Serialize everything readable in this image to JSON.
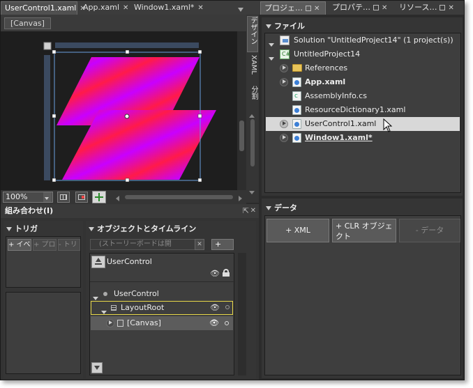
{
  "doc_tabs": [
    {
      "label": "UserControl1.xaml",
      "active": true
    },
    {
      "label": "App.xaml",
      "active": false
    },
    {
      "label": "Window1.xaml*",
      "active": false
    }
  ],
  "panel_tabs": [
    {
      "label": "プロジェ…",
      "active": true
    },
    {
      "label": "プロパテ…",
      "active": false
    },
    {
      "label": "リソース…",
      "active": false
    }
  ],
  "breadcrumb": "[Canvas]",
  "side_tabs": [
    "デザイン",
    "XAML",
    "分割"
  ],
  "zoom": "100%",
  "files": {
    "header": "ファイル",
    "items": [
      {
        "label": "Solution \"UntitledProject14\" (1 project(s))",
        "icon": "solution-icon",
        "bold": false
      },
      {
        "label": "UntitledProject14",
        "icon": "project-icon",
        "bold": false
      },
      {
        "label": "References",
        "icon": "folder-icon",
        "bold": false
      },
      {
        "label": "App.xaml",
        "icon": "xaml-file-icon",
        "bold": true
      },
      {
        "label": "AssemblyInfo.cs",
        "icon": "cs-file-icon",
        "bold": false
      },
      {
        "label": "ResourceDictionary1.xaml",
        "icon": "xaml-file-icon",
        "bold": false
      },
      {
        "label": "UserControl1.xaml",
        "icon": "xaml-file-icon",
        "bold": false
      },
      {
        "label": "Window1.xaml*",
        "icon": "xaml-file-icon",
        "bold": true
      }
    ]
  },
  "data_panel": {
    "header": "データ",
    "buttons": [
      "+ XML",
      "+ CLR オブジェクト",
      "- データ"
    ]
  },
  "interaction": {
    "header": "組み合わせ(I)",
    "triggers_header": "トリガ",
    "trigger_buttons": [
      "+ イベ",
      "+ プロ",
      "- トリ"
    ],
    "objects_header": "オブジェクトとタイムライン",
    "storyboard_placeholder": "(ストーリーボードは開",
    "root_label": "UserControl",
    "tree": [
      "UserControl",
      "LayoutRoot",
      "[Canvas]"
    ]
  },
  "colors": {
    "accent_selection": "#d8d8d8",
    "layoutroot_border": "#e8d84a",
    "shape_gradient": [
      "#ff1a4a",
      "#c800ff"
    ]
  }
}
